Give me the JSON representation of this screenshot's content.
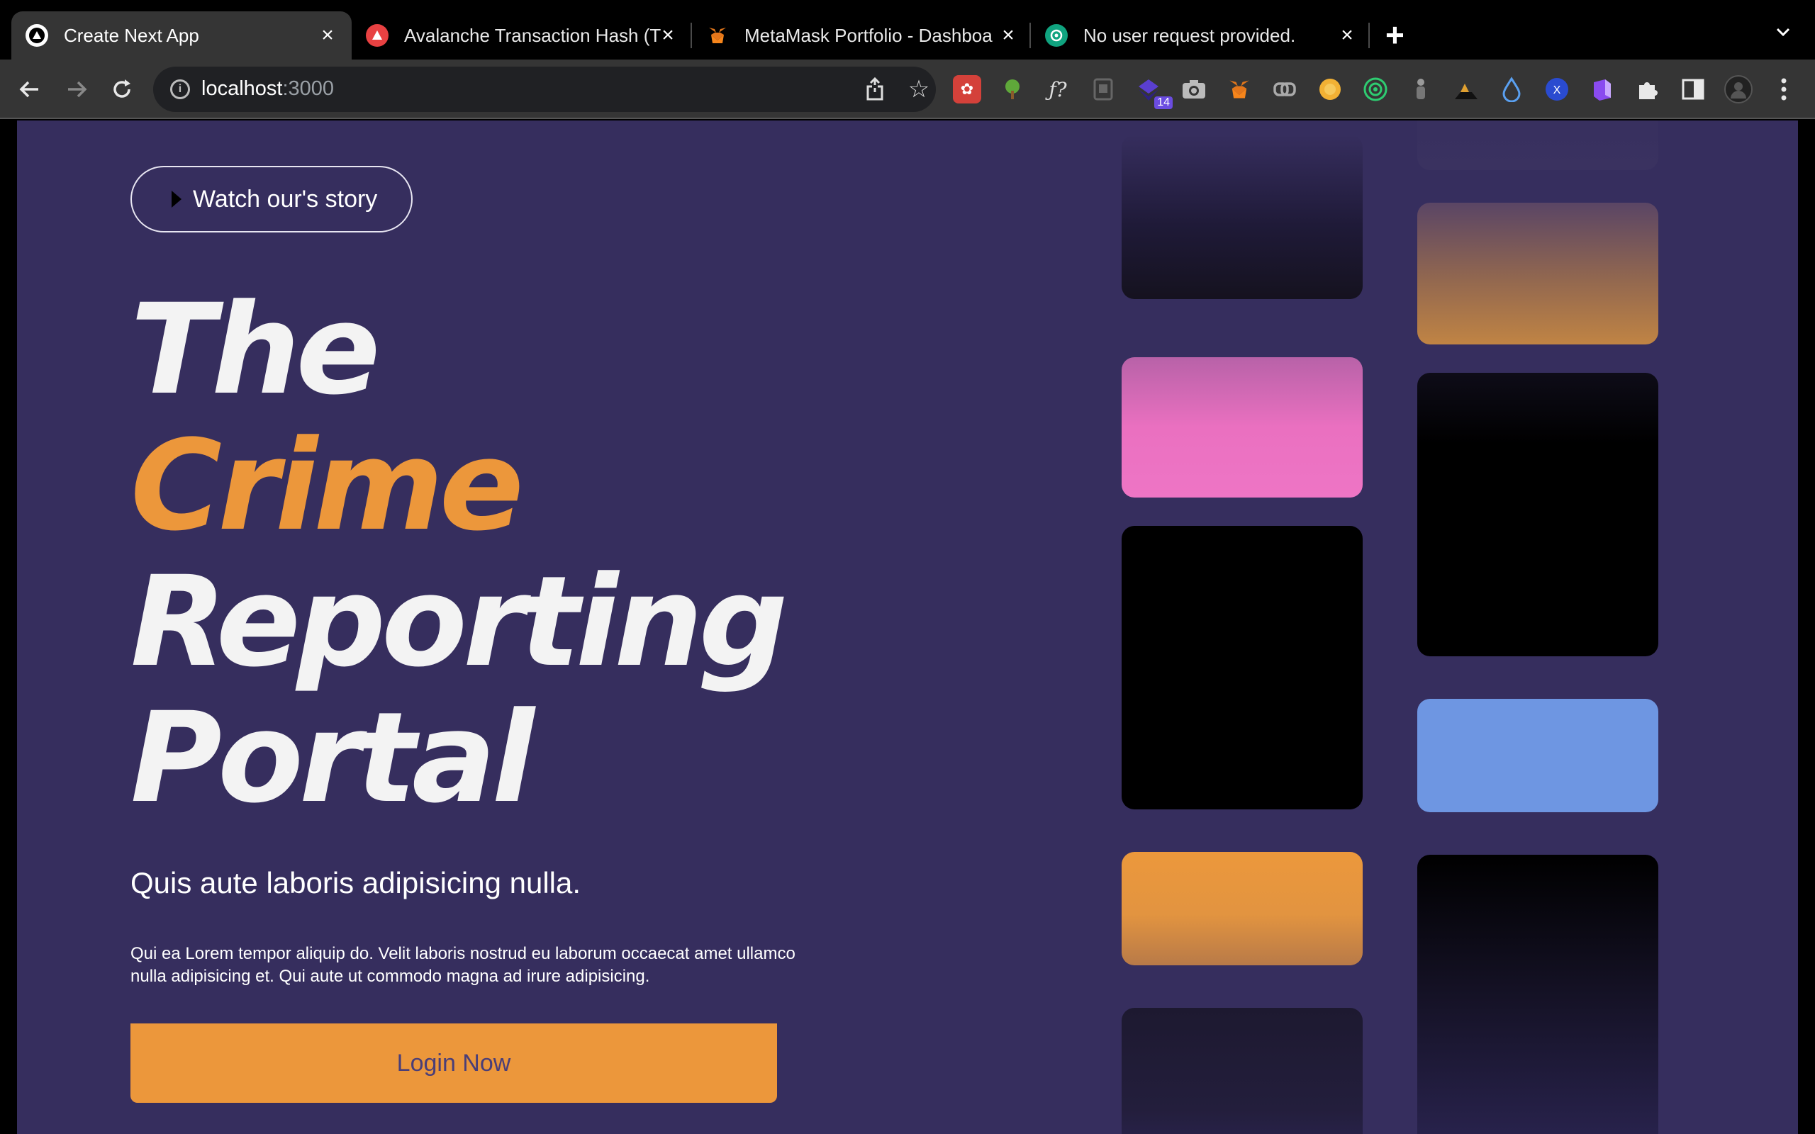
{
  "browser": {
    "tabs": [
      {
        "title": "Create Next App",
        "icon": "nextjs-icon",
        "active": true
      },
      {
        "title": "Avalanche Transaction Hash (T",
        "icon": "avalanche-icon",
        "active": false
      },
      {
        "title": "MetaMask Portfolio - Dashboa",
        "icon": "metamask-icon",
        "active": false
      },
      {
        "title": "No user request provided.",
        "icon": "openai-icon",
        "active": false
      }
    ],
    "address": {
      "host": "localhost",
      "port": ":3000"
    },
    "extension_badge": "14"
  },
  "hero": {
    "story_button": "Watch our's story",
    "headline": {
      "line1": "The",
      "line2": "Crime",
      "line3": "Reporting",
      "line4": "Portal"
    },
    "subtitle": "Quis aute laboris adipisicing nulla.",
    "body": "Qui ea Lorem tempor aliquip do. Velit laboris nostrud eu laborum occaecat amet ullamco nulla adipisicing et. Qui aute ut commodo magna ad irure adipisicing.",
    "login_button": "Login Now"
  },
  "colors": {
    "page_bg": "#362e5e",
    "accent": "#ec973b",
    "pink": "#ec6fbf",
    "blue": "#6e96e2",
    "dark": "#000000"
  }
}
